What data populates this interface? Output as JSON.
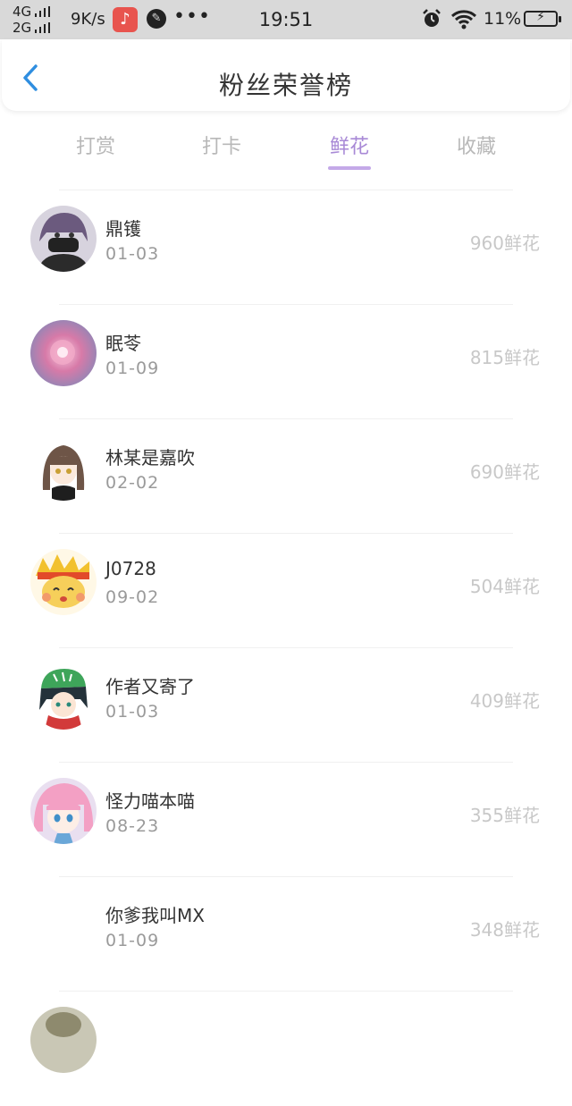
{
  "status_bar": {
    "net_top": "4G",
    "net_bottom": "2G",
    "speed": "9K/s",
    "time": "19:51",
    "battery": "11%"
  },
  "header": {
    "title": "粉丝荣誉榜"
  },
  "tabs": [
    {
      "label": "打赏"
    },
    {
      "label": "打卡"
    },
    {
      "label": "鲜花"
    },
    {
      "label": "收藏"
    }
  ],
  "active_tab": "鲜花",
  "colors": {
    "accent": "#a889d6",
    "back_arrow": "#2f8ee0"
  },
  "fans": [
    {
      "name": "鼎镬",
      "date": "01-03",
      "count": "960鲜花"
    },
    {
      "name": "眠苓",
      "date": "01-09",
      "count": "815鲜花"
    },
    {
      "name": "林某是嘉吹",
      "date": "02-02",
      "count": "690鲜花"
    },
    {
      "name": "J0728",
      "date": "09-02",
      "count": "504鲜花"
    },
    {
      "name": "作者又寄了",
      "date": "01-03",
      "count": "409鲜花"
    },
    {
      "name": "怪力喵本喵",
      "date": "08-23",
      "count": "355鲜花"
    },
    {
      "name": "你爹我叫MX",
      "date": "01-09",
      "count": "348鲜花"
    }
  ]
}
